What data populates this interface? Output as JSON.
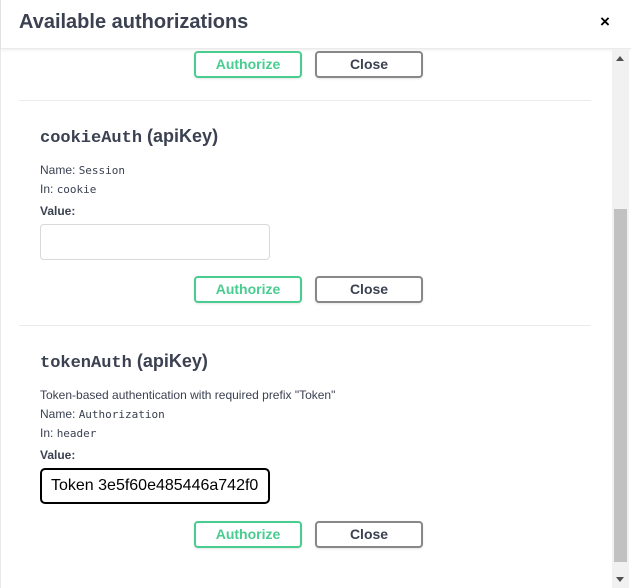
{
  "modal": {
    "title": "Available authorizations",
    "close_symbol": "×"
  },
  "buttons": {
    "authorize": "Authorize",
    "close": "Close"
  },
  "cookieAuth": {
    "name_mono": "cookieAuth",
    "type": "(apiKey)",
    "name_label": "Name:",
    "name_value": "Session",
    "in_label": "In:",
    "in_value": "cookie",
    "value_label": "Value:",
    "value": ""
  },
  "tokenAuth": {
    "name_mono": "tokenAuth",
    "type": "(apiKey)",
    "description": "Token-based authentication with required prefix \"Token\"",
    "name_label": "Name:",
    "name_value": "Authorization",
    "in_label": "In:",
    "in_value": "header",
    "value_label": "Value:",
    "value": "Token 3e5f60e485446a742f0"
  },
  "colors": {
    "authorize": "#49cc90",
    "text": "#3b4151"
  }
}
